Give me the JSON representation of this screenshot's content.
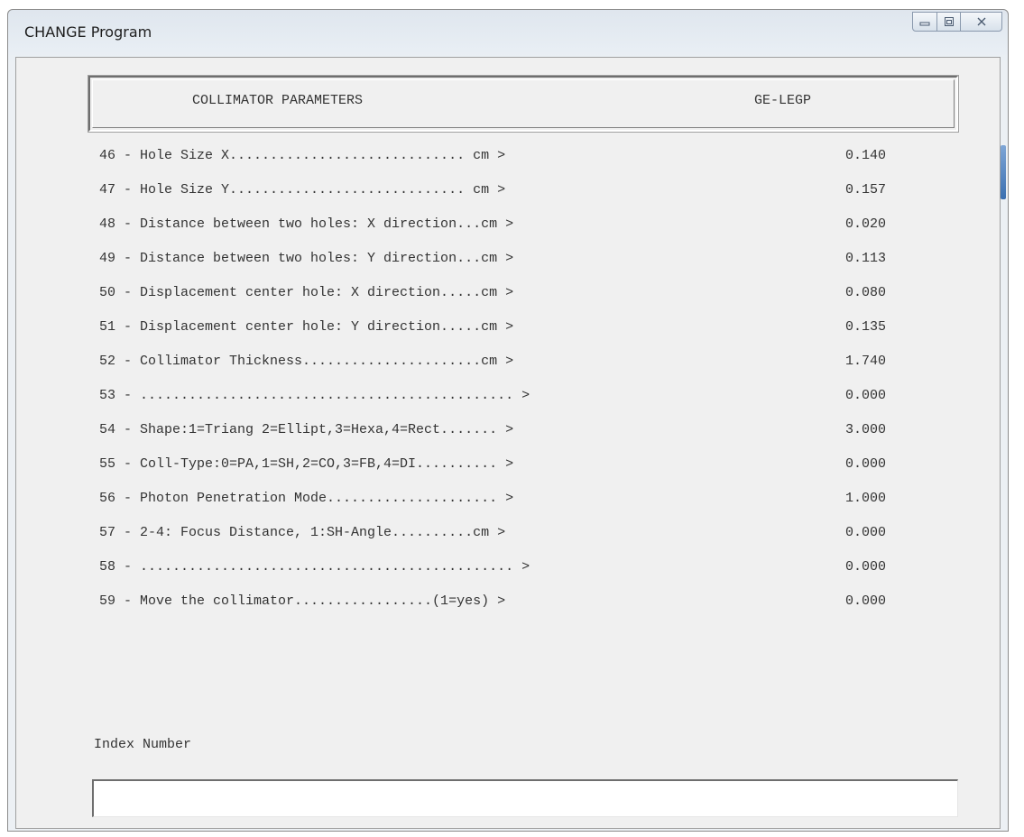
{
  "window": {
    "title": "CHANGE Program",
    "controls": {
      "minimize_icon": "minimize-icon",
      "maximize_icon": "maximize-icon",
      "close_icon": "close-icon"
    }
  },
  "header": {
    "title": "COLLIMATOR PARAMETERS",
    "identifier": "GE-LEGP"
  },
  "parameters": [
    {
      "label": "46 - Hole Size X............................. cm >",
      "value": "0.140"
    },
    {
      "label": "47 - Hole Size Y............................. cm >",
      "value": "0.157"
    },
    {
      "label": "48 - Distance between two holes: X direction...cm >",
      "value": "0.020"
    },
    {
      "label": "49 - Distance between two holes: Y direction...cm >",
      "value": "0.113"
    },
    {
      "label": "50 - Displacement center hole: X direction.....cm >",
      "value": "0.080"
    },
    {
      "label": "51 - Displacement center hole: Y direction.....cm >",
      "value": "0.135"
    },
    {
      "label": "52 - Collimator Thickness......................cm >",
      "value": "1.740"
    },
    {
      "label": "53 - .............................................. >",
      "value": "0.000"
    },
    {
      "label": "54 - Shape:1=Triang 2=Ellipt,3=Hexa,4=Rect....... >",
      "value": "3.000"
    },
    {
      "label": "55 - Coll-Type:0=PA,1=SH,2=CO,3=FB,4=DI.......... >",
      "value": "0.000"
    },
    {
      "label": "56 - Photon Penetration Mode..................... >",
      "value": "1.000"
    },
    {
      "label": "57 - 2-4: Focus Distance, 1:SH-Angle..........cm >",
      "value": "0.000"
    },
    {
      "label": "58 - .............................................. >",
      "value": "0.000"
    },
    {
      "label": "59 - Move the collimator.................(1=yes) >",
      "value": "0.000"
    }
  ],
  "index": {
    "label": "Index Number",
    "value": ""
  }
}
